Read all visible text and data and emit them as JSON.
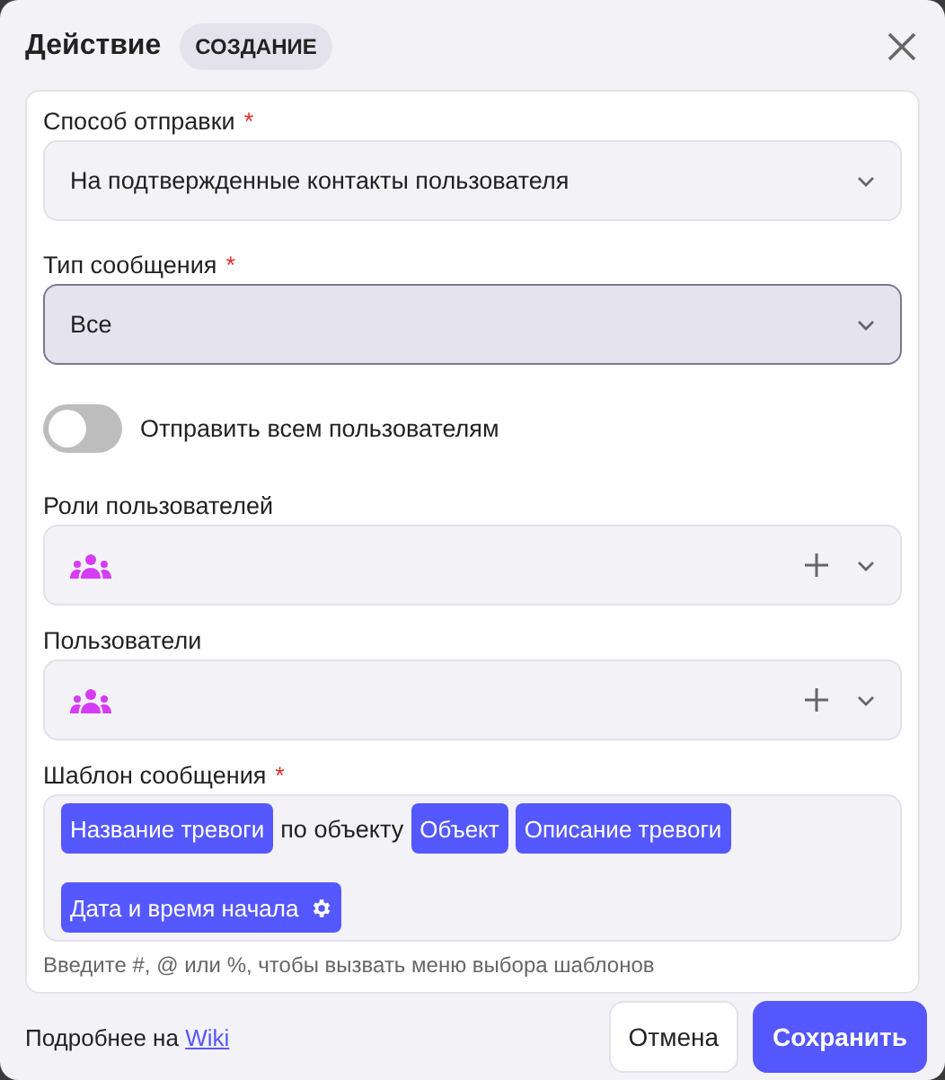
{
  "dialog": {
    "title": "Действие",
    "badge": "СОЗДАНИЕ"
  },
  "fields": [
    {
      "kind": "select",
      "label": "Способ отправки",
      "mark": "*",
      "value": "На подтвержденные контакты пользователя",
      "focused": false
    },
    {
      "kind": "select",
      "label": "Тип сообщения",
      "mark": "*",
      "value": "Все",
      "focused": true
    },
    {
      "kind": "toggle",
      "label": "Отправить всем пользователям",
      "on": false
    },
    {
      "kind": "multiselect",
      "label": "Роли пользователей"
    },
    {
      "kind": "multiselect",
      "label": "Пользователи"
    },
    {
      "kind": "template",
      "label": "Шаблон сообщения",
      "mark": "*",
      "hint": "Введите #, @ или %, чтобы вызвать меню выбора шаблонов",
      "parts": [
        {
          "kind": "token",
          "text": "Название тревоги"
        },
        {
          "kind": "text",
          "text": "по объекту"
        },
        {
          "kind": "token",
          "text": "Объект"
        },
        {
          "kind": "token",
          "text": "Описание тревоги"
        },
        {
          "kind": "break"
        },
        {
          "kind": "token-settings",
          "text": "Дата и время начала"
        }
      ]
    }
  ],
  "footer": {
    "info": "Подробнее на",
    "link": "Wiki",
    "buttons": [
      {
        "kind": "secondary",
        "label": "Отмена"
      },
      {
        "kind": "primary",
        "label": "Сохранить"
      }
    ]
  }
}
